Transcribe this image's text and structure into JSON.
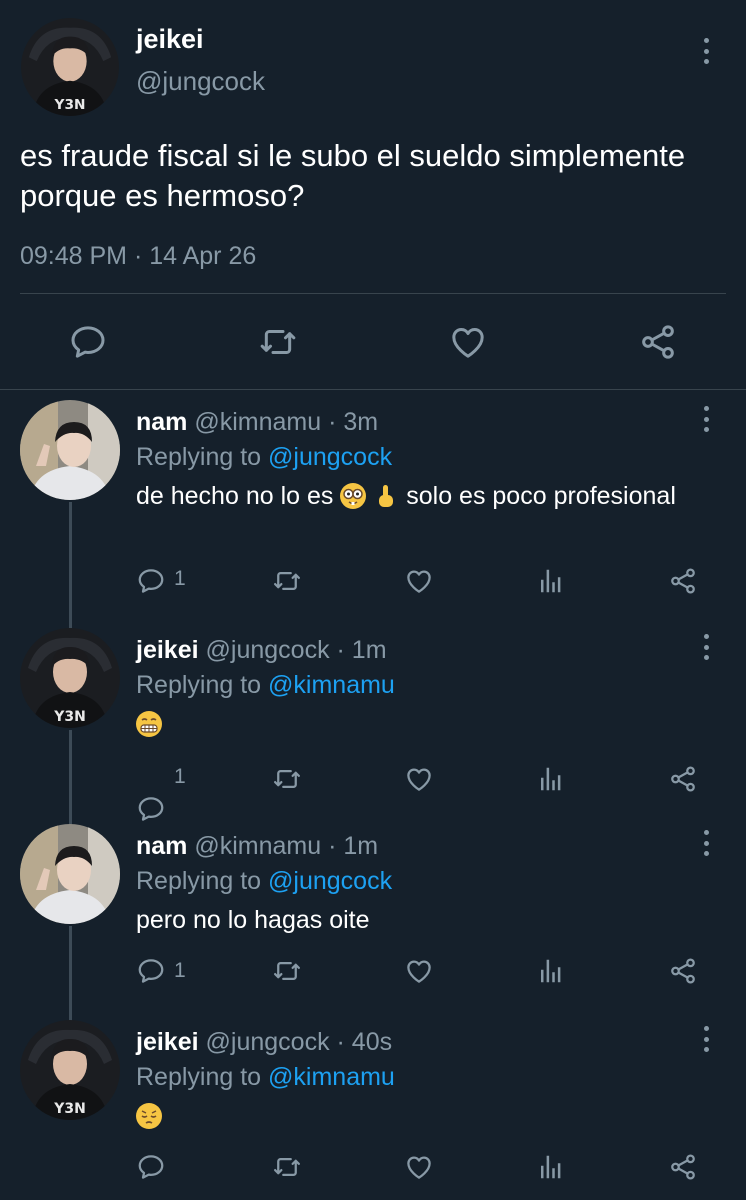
{
  "main_tweet": {
    "name": "jeikei",
    "handle": "@jungcock",
    "text": "es fraude fiscal si le subo el sueldo simplemente porque es hermoso?",
    "timestamp": "09:48 PM · 14 Apr 26",
    "actions": [
      "reply-icon",
      "retweet-icon",
      "like-icon",
      "share-icon"
    ]
  },
  "replies": [
    {
      "name": "nam",
      "handle": "@kimnamu",
      "time": "· 3m",
      "replying_prefix": "Replying to",
      "replying_to": "@jungcock",
      "text_before": "de hecho no lo es",
      "emojis": [
        "nerd-face-emoji",
        "index-pointing-up-emoji"
      ],
      "text_after": "solo es poco profesional",
      "reply_count": "1"
    },
    {
      "name": "jeikei",
      "handle": "@jungcock",
      "time": "· 1m",
      "replying_prefix": "Replying to",
      "replying_to": "@kimnamu",
      "emojis": [
        "grimacing-face-emoji"
      ],
      "reply_count": "1"
    },
    {
      "name": "nam",
      "handle": "@kimnamu",
      "time": "· 1m",
      "replying_prefix": "Replying to",
      "replying_to": "@jungcock",
      "text": "pero no lo hagas oite",
      "reply_count": "1"
    },
    {
      "name": "jeikei",
      "handle": "@jungcock",
      "time": "· 40s",
      "replying_prefix": "Replying to",
      "replying_to": "@kimnamu",
      "emojis": [
        "pensive-face-emoji"
      ],
      "reply_count": ""
    }
  ],
  "colors": {
    "background": "#15202b",
    "text": "#ffffff",
    "secondary": "#8899a6",
    "accent": "#1da1f2",
    "divider": "#38444d"
  }
}
